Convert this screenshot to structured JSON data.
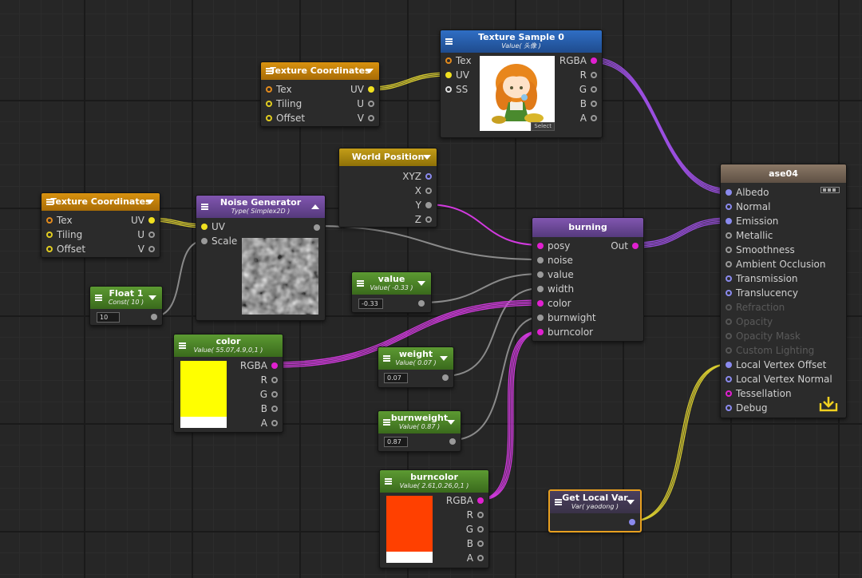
{
  "nodes": {
    "texcoord_top": {
      "title": "Texture Coordinates",
      "inputs": [
        "Tex",
        "Tiling",
        "Offset"
      ],
      "outputs": [
        "UV",
        "U",
        "V"
      ]
    },
    "texture_sample": {
      "title": "Texture Sample 0",
      "subtitle": "Value( 头像 )",
      "inputs": [
        "Tex",
        "UV",
        "SS"
      ],
      "outputs": [
        "RGBA",
        "R",
        "G",
        "B",
        "A"
      ],
      "select_label": "Select"
    },
    "world_position": {
      "title": "World Position",
      "outputs": [
        "XYZ",
        "X",
        "Y",
        "Z"
      ]
    },
    "texcoord_left": {
      "title": "Texture Coordinates",
      "inputs": [
        "Tex",
        "Tiling",
        "Offset"
      ],
      "outputs": [
        "UV",
        "U",
        "V"
      ]
    },
    "noise": {
      "title": "Noise Generator",
      "subtitle": "Type( Simplex2D )",
      "inputs": [
        "UV",
        "Scale"
      ]
    },
    "float1": {
      "title": "Float 1",
      "subtitle": "Const( 10 )",
      "value": "10"
    },
    "value": {
      "title": "value",
      "subtitle": "Value( -0.33 )",
      "value": "-0.33"
    },
    "burning": {
      "title": "burning",
      "inputs": [
        "posy",
        "noise",
        "value",
        "width",
        "color",
        "burnwight",
        "burncolor"
      ],
      "output": "Out"
    },
    "color": {
      "title": "color",
      "subtitle": "Value( 55.07,4.9,0,1 )",
      "outputs": [
        "RGBA",
        "R",
        "G",
        "B",
        "A"
      ],
      "swatch_color": "#ffff00"
    },
    "weight": {
      "title": "weight",
      "subtitle": "Value( 0.07 )",
      "value": "0.07"
    },
    "burnweight": {
      "title": "burnweight",
      "subtitle": "Value( 0.87 )",
      "value": "0.87"
    },
    "burncolor": {
      "title": "burncolor",
      "subtitle": "Value( 2.61,0.26,0,1 )",
      "outputs": [
        "RGBA",
        "R",
        "G",
        "B",
        "A"
      ],
      "swatch_color": "#ff4000"
    },
    "get_local_var": {
      "title": "Get Local Var",
      "subtitle": "Var( yaodong )"
    },
    "master": {
      "title": "ase04",
      "inputs": [
        "Albedo",
        "Normal",
        "Emission",
        "Metallic",
        "Smoothness",
        "Ambient Occlusion",
        "Transmission",
        "Translucency",
        "Refraction",
        "Opacity",
        "Opacity Mask",
        "Custom Lighting",
        "Local Vertex Offset",
        "Local Vertex Normal",
        "Tessellation",
        "Debug"
      ]
    }
  },
  "colors": {
    "wire_purple": "#9b4fe0",
    "wire_magenta": "#d23adf",
    "wire_yellow": "#d8cc30",
    "wire_gray": "#8a8a8a",
    "selected_border": "#e8a020"
  },
  "icons": {
    "master_corner": "download-icon"
  }
}
